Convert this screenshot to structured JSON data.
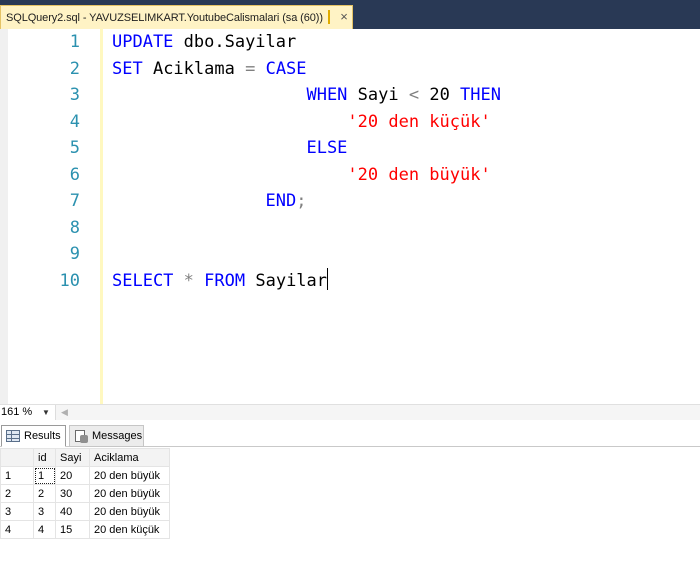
{
  "tab": {
    "title": "SQLQuery2.sql - YAVUZSELIMKART.YoutubeCalismalari (sa (60))",
    "close_glyph": "×"
  },
  "editor": {
    "lines": [
      {
        "num": "1",
        "tokens": [
          {
            "t": "UPDATE",
            "c": "kw"
          },
          {
            "t": " dbo.Sayilar",
            "c": ""
          }
        ]
      },
      {
        "num": "2",
        "tokens": [
          {
            "t": "SET",
            "c": "kw"
          },
          {
            "t": " Aciklama ",
            "c": ""
          },
          {
            "t": "=",
            "c": "op"
          },
          {
            "t": " ",
            "c": ""
          },
          {
            "t": "CASE",
            "c": "kw"
          }
        ]
      },
      {
        "num": "3",
        "tokens": [
          {
            "t": "                   ",
            "c": ""
          },
          {
            "t": "WHEN",
            "c": "kw"
          },
          {
            "t": " Sayi ",
            "c": ""
          },
          {
            "t": "<",
            "c": "op"
          },
          {
            "t": " 20 ",
            "c": ""
          },
          {
            "t": "THEN",
            "c": "kw"
          }
        ]
      },
      {
        "num": "4",
        "tokens": [
          {
            "t": "                       ",
            "c": ""
          },
          {
            "t": "'20 den küçük'",
            "c": "str"
          }
        ]
      },
      {
        "num": "5",
        "tokens": [
          {
            "t": "                   ",
            "c": ""
          },
          {
            "t": "ELSE",
            "c": "kw"
          }
        ]
      },
      {
        "num": "6",
        "tokens": [
          {
            "t": "                       ",
            "c": ""
          },
          {
            "t": "'20 den büyük'",
            "c": "str"
          }
        ]
      },
      {
        "num": "7",
        "tokens": [
          {
            "t": "               ",
            "c": ""
          },
          {
            "t": "END",
            "c": "kw"
          },
          {
            "t": ";",
            "c": "op"
          }
        ]
      },
      {
        "num": "8",
        "tokens": []
      },
      {
        "num": "9",
        "tokens": []
      },
      {
        "num": "10",
        "tokens": [
          {
            "t": "SELECT",
            "c": "kw"
          },
          {
            "t": " ",
            "c": ""
          },
          {
            "t": "*",
            "c": "op"
          },
          {
            "t": " ",
            "c": ""
          },
          {
            "t": "FROM",
            "c": "kw"
          },
          {
            "t": " Sayilar",
            "c": ""
          }
        ],
        "caret": true
      }
    ],
    "colors": {
      "keyword": "#0000ff",
      "string": "#ff0000",
      "operator": "#808080",
      "line_number": "#2b91af",
      "change_margin": "#fff8c0"
    }
  },
  "zoom": {
    "value": "161 %",
    "arrow_icon": "chevron-down-icon",
    "scroll_icon": "scroll-left-icon"
  },
  "results": {
    "tabs": [
      {
        "label": "Results",
        "icon": "grid-icon",
        "active": true
      },
      {
        "label": "Messages",
        "icon": "messages-icon",
        "active": false
      }
    ],
    "columns": [
      "",
      "id",
      "Sayi",
      "Aciklama"
    ],
    "rows": [
      [
        "1",
        "1",
        "20",
        "20 den büyük"
      ],
      [
        "2",
        "2",
        "30",
        "20 den büyük"
      ],
      [
        "3",
        "3",
        "40",
        "20 den büyük"
      ],
      [
        "4",
        "4",
        "15",
        "20 den küçük"
      ]
    ]
  }
}
